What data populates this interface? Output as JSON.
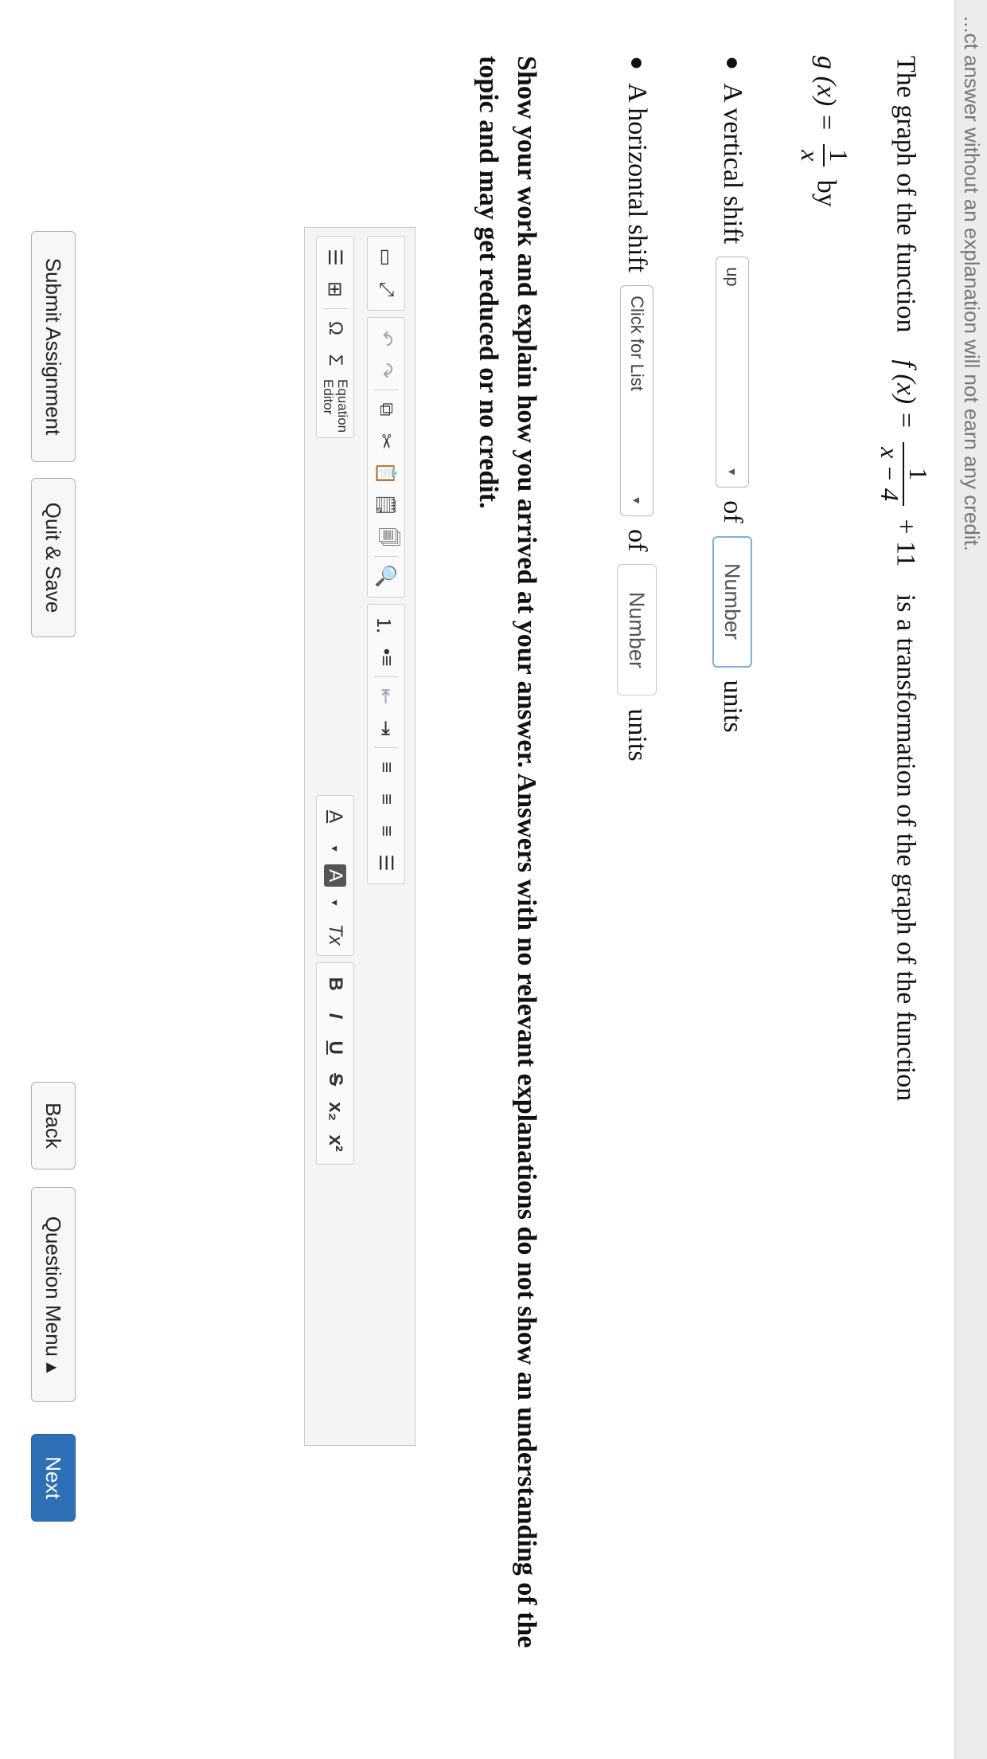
{
  "top_banner": "...ct answer without an explanation will not earn any credit.",
  "question": {
    "intro": "The graph of the function",
    "f_name": "f (x) =",
    "f_numerator": "1",
    "f_denominator": "x − 4",
    "f_tail": "+ 11",
    "middle": "is a transformation of the graph of the function",
    "g_name": "g (x) =",
    "g_numerator": "1",
    "g_denominator": "x",
    "by": "by"
  },
  "vertical_shift": {
    "label": "A vertical shift",
    "select_value": "up",
    "of": "of",
    "number_placeholder": "Number",
    "units": "units"
  },
  "horizontal_shift": {
    "label": "A horizontal shift",
    "select_value": "Click for List",
    "of": "of",
    "number_placeholder": "Number",
    "units": "units"
  },
  "instructions": "Show your work and explain how you arrived at your answer. Answers with no relevant explanations do not show an understanding of the topic and may get reduced or no credit.",
  "editor": {
    "equation_editor_line1": "Equation",
    "equation_editor_line2": "Editor",
    "bold": "B",
    "italic": "I",
    "underline": "U",
    "strike": "S",
    "subscript": "x₂",
    "superscript": "x²",
    "font_color": "A",
    "bg_color": "A",
    "clear_format": "Tx",
    "omega": "Ω",
    "sigma": "Σ"
  },
  "buttons": {
    "submit": "Submit Assignment",
    "quit_save": "Quit & Save",
    "back": "Back",
    "question_menu": "Question Menu ▴",
    "next": "Next"
  },
  "colors": {
    "next_button": "#2f6fb5",
    "focus_border": "#7fb0d8"
  }
}
